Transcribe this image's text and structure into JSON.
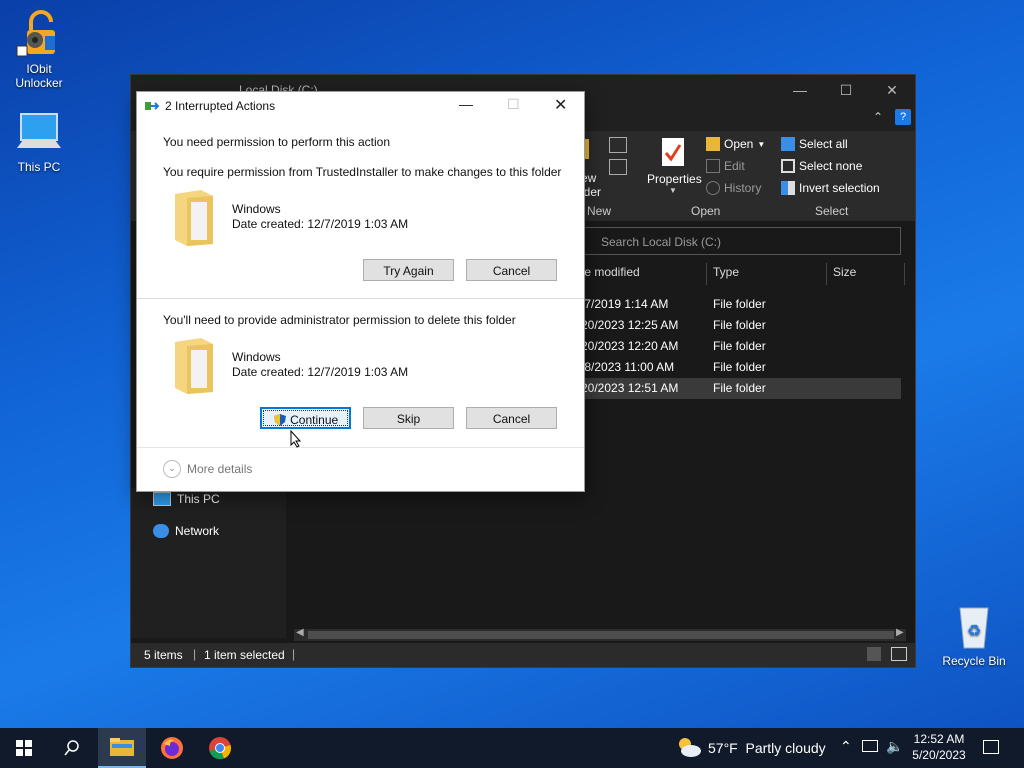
{
  "desktop": {
    "icons": [
      {
        "label1": "IObit",
        "label2": "Unlocker"
      },
      {
        "label1": "This PC"
      },
      {
        "label1": "Recycle Bin"
      }
    ]
  },
  "explorer": {
    "title": "Local Disk (C:)",
    "ribbon": {
      "new_partial": "ew",
      "new_partial2": "lder",
      "properties": "Properties",
      "open": "Open",
      "edit": "Edit",
      "history": "History",
      "select_all": "Select all",
      "select_none": "Select none",
      "invert_selection": "Invert selection",
      "group_new": "New",
      "group_open": "Open",
      "group_select": "Select"
    },
    "search_placeholder": "Search Local Disk (C:)",
    "columns": {
      "date": "te modified",
      "type": "Type",
      "size": "Size"
    },
    "rows": [
      {
        "date": "/7/2019 1:14 AM",
        "type": "File folder"
      },
      {
        "date": "20/2023 12:25 AM",
        "type": "File folder"
      },
      {
        "date": "20/2023 12:20 AM",
        "type": "File folder"
      },
      {
        "date": "/8/2023 11:00 AM",
        "type": "File folder"
      },
      {
        "date": "20/2023 12:51 AM",
        "type": "File folder"
      }
    ],
    "nav": {
      "this_pc": "This PC",
      "network": "Network"
    },
    "status": {
      "items": "5 items",
      "selected": "1 item selected"
    }
  },
  "dialog": {
    "title": "2 Interrupted Actions",
    "heading": "You need permission to perform this action",
    "message1": "You require permission from TrustedInstaller to make changes to this folder",
    "item1_name": "Windows",
    "item1_date": "Date created: 12/7/2019 1:03 AM",
    "try_again": "Try Again",
    "cancel1": "Cancel",
    "message2": "You'll need to provide administrator permission to delete this folder",
    "item2_name": "Windows",
    "item2_date": "Date created: 12/7/2019 1:03 AM",
    "continue": "Continue",
    "skip": "Skip",
    "cancel2": "Cancel",
    "more_details": "More details"
  },
  "taskbar": {
    "weather": "57°F  Partly cloudy",
    "time": "12:52 AM",
    "date": "5/20/2023"
  },
  "colors": {
    "accent": "#0078d7",
    "explorer_bg": "#191919",
    "dialog_bg": "#ffffff"
  }
}
